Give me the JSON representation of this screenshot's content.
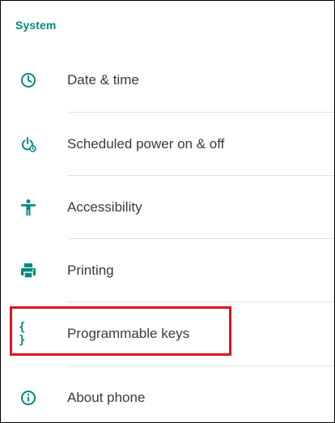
{
  "section": {
    "title": "System"
  },
  "items": [
    {
      "label": "Date & time",
      "icon": "clock-icon"
    },
    {
      "label": "Scheduled power on & off",
      "icon": "power-schedule-icon"
    },
    {
      "label": "Accessibility",
      "icon": "accessibility-icon"
    },
    {
      "label": "Printing",
      "icon": "printer-icon"
    },
    {
      "label": "Programmable keys",
      "icon": "braces-icon",
      "icon_glyph": "{ }",
      "highlighted": true
    },
    {
      "label": "About phone",
      "icon": "info-icon"
    }
  ],
  "colors": {
    "accent": "#00897b",
    "highlight_border": "#e3141d",
    "text": "#3a3a3a",
    "divider": "#e3e3e3"
  }
}
